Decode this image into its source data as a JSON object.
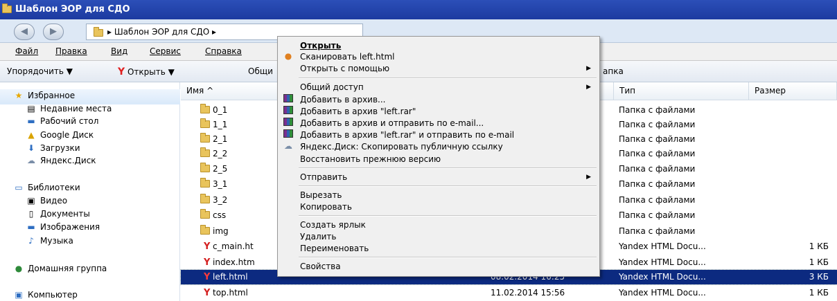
{
  "window": {
    "title": "Шаблон ЭОР для СДО"
  },
  "address": {
    "path": "▸ Шаблон ЭОР для СДО ▸"
  },
  "menubar": [
    "Файл",
    "Правка",
    "Вид",
    "Сервис",
    "Справка"
  ],
  "toolbar": {
    "organize": "Упорядочить ▼",
    "open": "Открыть ▼",
    "share": "Общи",
    "newfolder": "апка"
  },
  "nav": {
    "favorites": "Избранное",
    "fav_items": [
      "Недавние места",
      "Рабочий стол",
      "Google Диск",
      "Загрузки",
      "Яндекс.Диск"
    ],
    "libraries": "Библиотеки",
    "lib_items": [
      "Видео",
      "Документы",
      "Изображения",
      "Музыка"
    ],
    "homegroup": "Домашняя группа",
    "computer": "Компьютер"
  },
  "columns": {
    "name": "Имя ^",
    "type": "Тип",
    "size": "Размер"
  },
  "files": [
    {
      "name": "0_1",
      "date": "",
      "type": "Папка с файлами",
      "size": ""
    },
    {
      "name": "1_1",
      "date": "",
      "type": "Папка с файлами",
      "size": ""
    },
    {
      "name": "2_1",
      "date": "",
      "type": "Папка с файлами",
      "size": ""
    },
    {
      "name": "2_2",
      "date": "",
      "type": "Папка с файлами",
      "size": ""
    },
    {
      "name": "2_5",
      "date": "",
      "type": "Папка с файлами",
      "size": ""
    },
    {
      "name": "3_1",
      "date": "",
      "type": "Папка с файлами",
      "size": ""
    },
    {
      "name": "3_2",
      "date": "",
      "type": "Папка с файлами",
      "size": ""
    },
    {
      "name": "css",
      "date": "",
      "type": "Папка с файлами",
      "size": ""
    },
    {
      "name": "img",
      "date": "",
      "type": "Папка с файлами",
      "size": ""
    },
    {
      "name": "c_main.ht",
      "date": "",
      "type": "Yandex HTML Docu...",
      "size": "1 КБ"
    },
    {
      "name": "index.htm",
      "date": "",
      "type": "Yandex HTML Docu...",
      "size": "1 КБ"
    },
    {
      "name": "left.html",
      "date": "08.02.2014 16:25",
      "type": "Yandex HTML Docu...",
      "size": "3 КБ"
    },
    {
      "name": "top.html",
      "date": "11.02.2014 15:56",
      "type": "Yandex HTML Docu...",
      "size": "1 КБ"
    }
  ],
  "context_menu": {
    "open": "Открыть",
    "scan": "Сканировать left.html",
    "open_with": "Открыть с помощью",
    "share": "Общий доступ",
    "add_archive": "Добавить в архив...",
    "add_rar": "Добавить в архив \"left.rar\"",
    "add_archive_email": "Добавить в архив и отправить по e-mail...",
    "add_rar_email": "Добавить в архив \"left.rar\" и отправить по e-mail",
    "yadisk": "Яндекс.Диск: Скопировать публичную ссылку",
    "restore": "Восстановить прежнюю версию",
    "send_to": "Отправить",
    "cut": "Вырезать",
    "copy": "Копировать",
    "shortcut": "Создать ярлык",
    "delete": "Удалить",
    "rename": "Переименовать",
    "properties": "Свойства"
  }
}
